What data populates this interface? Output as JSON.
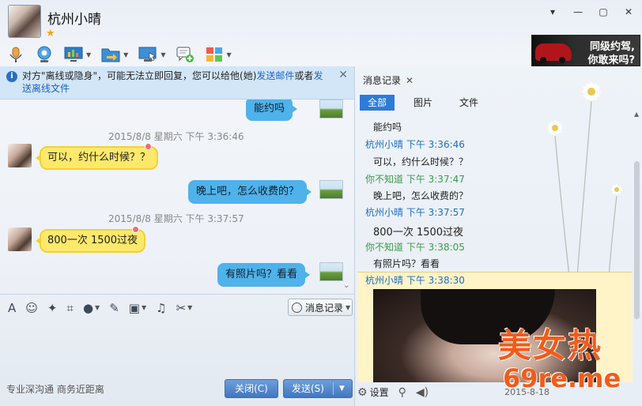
{
  "header": {
    "contact_name": "杭州小晴",
    "star_icon": "★",
    "window_controls": [
      "▾",
      "—",
      "▢",
      "✕"
    ]
  },
  "ad": {
    "line1": "同级约驾,",
    "line2": "你敢来吗?"
  },
  "toolbar": {
    "icons": [
      "voice-call-icon",
      "video-call-icon",
      "screen-share-icon",
      "file-transfer-icon",
      "remote-desktop-icon",
      "create-discussion-icon",
      "apps-icon"
    ]
  },
  "notice": {
    "text": "对方\"离线或隐身\"，可能无法立即回复，您可以给他(她)",
    "link1": "发送邮件",
    "or": "或者",
    "link2": "发送离线文件"
  },
  "chat": {
    "messages": [
      {
        "side": "self",
        "text": "能约吗"
      },
      {
        "time": "2015/8/8 星期六 下午 3:36:46"
      },
      {
        "side": "peer",
        "text": "可以，约什么时候？？"
      },
      {
        "side": "self",
        "text": "晚上吧，怎么收费的？"
      },
      {
        "time": "2015/8/8 星期六 下午 3:37:57"
      },
      {
        "side": "peer",
        "text": "800一次 1500过夜"
      },
      {
        "side": "self",
        "text": "有照片吗？看看"
      }
    ]
  },
  "input_toolbar": {
    "icons": [
      "font-icon",
      "emoji-icon",
      "nudge-icon",
      "screenshot-icon",
      "voice-message-icon",
      "edit-icon",
      "image-icon",
      "music-icon",
      "scissors-icon"
    ],
    "history_label": "消息记录"
  },
  "footer": {
    "slogan": "专业深沟通 商务近距离",
    "close_label": "关闭(C)",
    "send_label": "发送(S)"
  },
  "history": {
    "tab_label": "消息记录",
    "filters": [
      "全部",
      "图片",
      "文件"
    ],
    "entries": [
      {
        "type": "msg",
        "text": "能约吗"
      },
      {
        "type": "peer",
        "text": "杭州小晴  下午 3:36:46"
      },
      {
        "type": "msg",
        "text": "可以，约什么时候？？"
      },
      {
        "type": "self",
        "text": "你不知道  下午 3:37:47"
      },
      {
        "type": "msg",
        "text": "晚上吧，怎么收费的？"
      },
      {
        "type": "peer",
        "text": "杭州小晴  下午 3:37:57"
      },
      {
        "type": "msg",
        "text": "800一次 1500过夜"
      },
      {
        "type": "self",
        "text": "你不知道  下午 3:38:05"
      },
      {
        "type": "msg",
        "text": "有照片吗？看看"
      },
      {
        "type": "peer",
        "text": "杭州小晴  下午 3:38:30"
      }
    ],
    "settings_label": "设置",
    "date": "2015-8-18"
  },
  "watermark": {
    "line1": "美女热",
    "line2": "69re.me"
  }
}
